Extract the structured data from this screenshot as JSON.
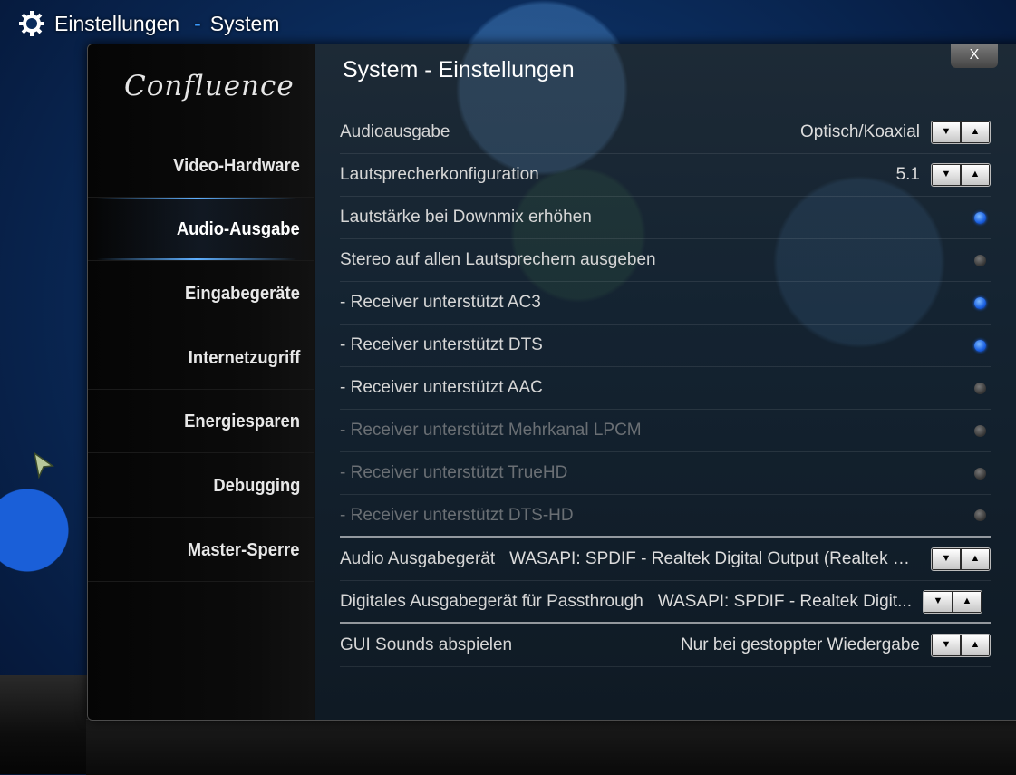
{
  "header": {
    "title": "Einstellungen",
    "separator": "-",
    "subtitle": "System"
  },
  "sidebar": {
    "logo": "Confluence",
    "items": [
      {
        "label": "Video-Hardware"
      },
      {
        "label": "Audio-Ausgabe",
        "active": true
      },
      {
        "label": "Eingabegeräte"
      },
      {
        "label": "Internetzugriff"
      },
      {
        "label": "Energiesparen"
      },
      {
        "label": "Debugging"
      },
      {
        "label": "Master-Sperre"
      }
    ]
  },
  "content": {
    "title": "System - Einstellungen",
    "close": "X",
    "spin_down": "▼",
    "spin_up": "▲",
    "rows": [
      {
        "label": "Audioausgabe",
        "value": "Optisch/Koaxial",
        "type": "spin"
      },
      {
        "label": "Lautsprecherkonfiguration",
        "value": "5.1",
        "type": "spin"
      },
      {
        "label": "Lautstärke bei Downmix erhöhen",
        "type": "radio",
        "checked": true
      },
      {
        "label": "Stereo auf allen Lautsprechern ausgeben",
        "type": "radio",
        "checked": false
      },
      {
        "label": "- Receiver unterstützt AC3",
        "type": "radio",
        "checked": true
      },
      {
        "label": "- Receiver unterstützt DTS",
        "type": "radio",
        "checked": true
      },
      {
        "label": "- Receiver unterstützt AAC",
        "type": "radio",
        "checked": false
      },
      {
        "label": "- Receiver unterstützt Mehrkanal LPCM",
        "type": "radio",
        "checked": false,
        "disabled": true
      },
      {
        "label": "- Receiver unterstützt TrueHD",
        "type": "radio",
        "checked": false,
        "disabled": true
      },
      {
        "label": "- Receiver unterstützt DTS-HD",
        "type": "radio",
        "checked": false,
        "disabled": true
      },
      {
        "label": "Audio Ausgabegerät",
        "value": "WASAPI: SPDIF - Realtek Digital Output (Realtek Hi...",
        "type": "spin"
      },
      {
        "label": "Digitales Ausgabegerät für Passthrough",
        "value": "WASAPI: SPDIF - Realtek Digit...",
        "type": "spin"
      },
      {
        "label": "GUI Sounds abspielen",
        "value": "Nur bei gestoppter Wiedergabe",
        "type": "spin"
      }
    ]
  },
  "colors": {
    "accent": "#3a9bff",
    "radio_on": "#1a5fe0",
    "radio_off": "#555555",
    "disabled_text": "#6a6f74"
  },
  "icons": {
    "header": "gear-icon",
    "pointer": "mouse-cursor-icon"
  }
}
